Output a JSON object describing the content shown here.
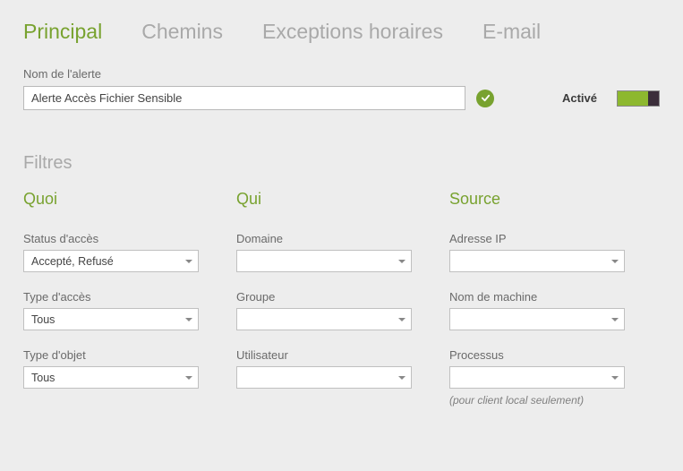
{
  "tabs": {
    "principal": "Principal",
    "chemins": "Chemins",
    "exceptions": "Exceptions horaires",
    "email": "E-mail"
  },
  "alert": {
    "name_label": "Nom de l'alerte",
    "name_value": "Alerte Accès Fichier Sensible",
    "activated_label": "Activé"
  },
  "filters": {
    "title": "Filtres",
    "quoi": {
      "title": "Quoi",
      "status_label": "Status d'accès",
      "status_value": "Accepté, Refusé",
      "access_type_label": "Type d'accès",
      "access_type_value": "Tous",
      "object_type_label": "Type d'objet",
      "object_type_value": "Tous"
    },
    "qui": {
      "title": "Qui",
      "domain_label": "Domaine",
      "domain_value": "",
      "group_label": "Groupe",
      "group_value": "",
      "user_label": "Utilisateur",
      "user_value": ""
    },
    "source": {
      "title": "Source",
      "ip_label": "Adresse IP",
      "ip_value": "",
      "machine_label": "Nom de machine",
      "machine_value": "",
      "process_label": "Processus",
      "process_value": "",
      "process_hint": "(pour client local seulement)"
    }
  }
}
